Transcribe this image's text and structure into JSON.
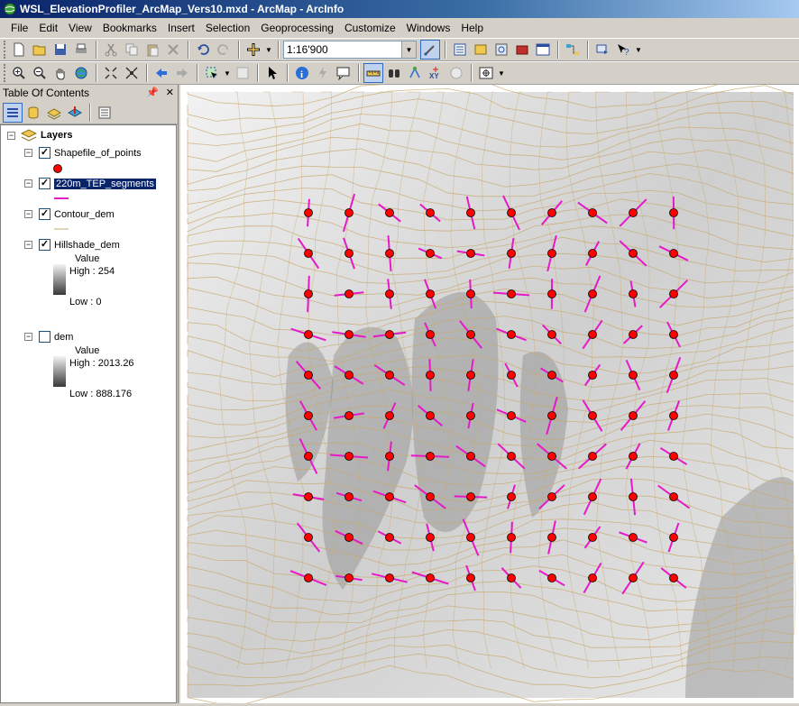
{
  "window": {
    "title": "WSL_ElevationProfiler_ArcMap_Vers10.mxd - ArcMap - ArcInfo",
    "app_icon": "globe-icon"
  },
  "menu": [
    "File",
    "Edit",
    "View",
    "Bookmarks",
    "Insert",
    "Selection",
    "Geoprocessing",
    "Customize",
    "Windows",
    "Help"
  ],
  "toolbar": {
    "scale": "1:16'900"
  },
  "toc": {
    "title": "Table Of Contents",
    "root_label": "Layers",
    "layers": [
      {
        "name": "Shapefile_of_points",
        "checked": true,
        "symbol": "red-point"
      },
      {
        "name": "220m_TEP_segments",
        "checked": true,
        "symbol": "magenta-line",
        "selected": true
      },
      {
        "name": "Contour_dem",
        "checked": true,
        "symbol": "tan-line"
      },
      {
        "name": "Hillshade_dem",
        "checked": true,
        "value_label": "Value",
        "high": "High : 254",
        "low": "Low : 0"
      },
      {
        "name": "dem",
        "checked": false,
        "value_label": "Value",
        "high": "High : 2013.26",
        "low": "Low : 888.176"
      }
    ]
  },
  "colors": {
    "point_fill": "#ff0000",
    "segment": "#e619c9",
    "contour": "#c8a96e",
    "selection": "#0a246a"
  },
  "map": {
    "grid_columns": 10,
    "grid_rows": 10
  }
}
